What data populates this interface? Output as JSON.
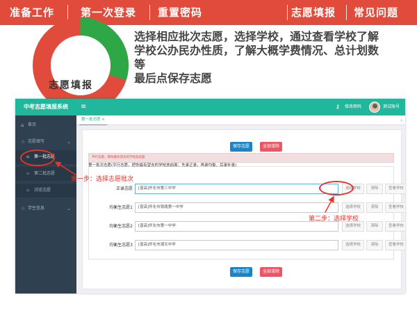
{
  "top_nav": {
    "items": [
      "准备工作",
      "第一次登录",
      "重置密码",
      "志愿填报",
      "常见问题"
    ]
  },
  "donut": {
    "label": "志愿填报",
    "colors": {
      "red": "#e14b3b",
      "green": "#2ea846"
    }
  },
  "headline": {
    "lines": [
      "选择相应批次志愿，选择学校，通过查看学校了解",
      "学校公办民办性质，了解大概学费情况、总计划数",
      "等",
      "最后点保存志愿"
    ]
  },
  "app": {
    "title": "中考志愿填报系统",
    "menu_icon": "≡",
    "change_password": "修改密码",
    "user_name": "测试账号",
    "accent_color": "#21b79c",
    "sidebar": {
      "home": "首页",
      "group": "志愿填写",
      "sub_items": [
        "第一批志愿",
        "第二批志愿",
        "浏览志愿"
      ],
      "student_info": "学生信息"
    },
    "tab": "第一批志愿 ×",
    "save_button": "保存志愿",
    "clear_all_button": "全部清除",
    "alert": "平行志愿，把你最有望去的学校放前面",
    "panel_desc": "第一批次志愿(平行志愿，把你最有望去的学校放前面；先录正录，再录均衡，后录补录)",
    "rows": [
      {
        "label": "正录志愿",
        "school": "[普高]怀化市第三中学"
      },
      {
        "label": "均衡生志愿1",
        "school": "[普高]怀化市铁路第一中学"
      },
      {
        "label": "均衡生志愿2",
        "school": "[普高]怀化市第一中学"
      },
      {
        "label": "均衡生志愿3",
        "school": "[普高]怀化市湖天中学"
      }
    ],
    "row_buttons": {
      "select": "选择学校",
      "clear": "清除",
      "view": "查看学校"
    }
  },
  "annotations": {
    "step1": "第一步：选择志愿批次",
    "step2": "第二步：选择学校",
    "color": "#e8322a"
  }
}
